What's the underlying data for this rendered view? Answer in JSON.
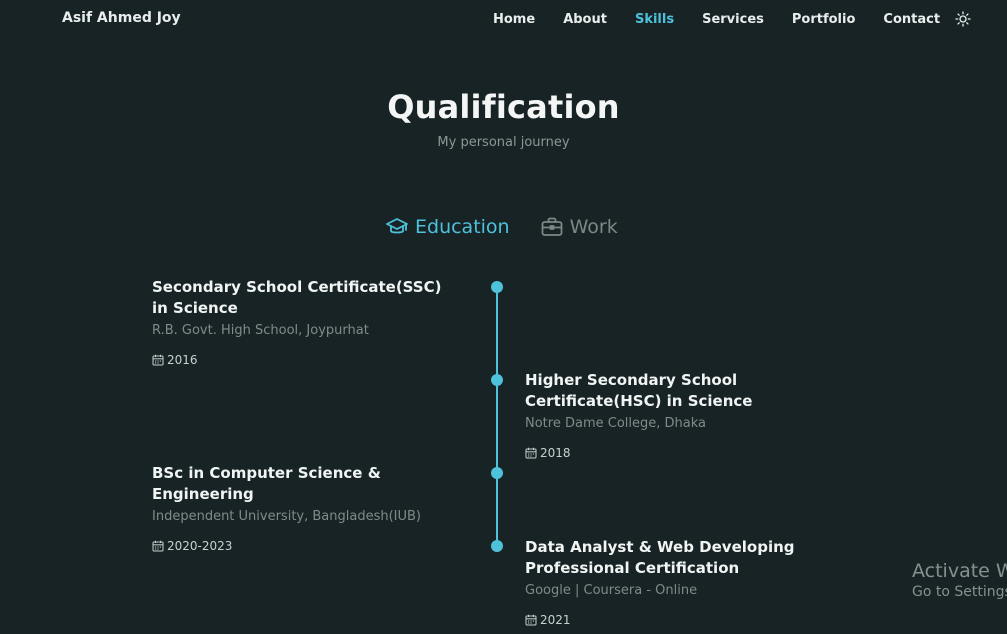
{
  "header": {
    "logo": "Asif Ahmed Joy",
    "nav": [
      "Home",
      "About",
      "Skills",
      "Services",
      "Portfolio",
      "Contact"
    ],
    "active_nav": "Skills",
    "theme_icon": "sun-icon"
  },
  "section": {
    "title": "Qualification",
    "subtitle": "My personal journey"
  },
  "tabs": {
    "education": {
      "label": "Education",
      "icon": "graduation-cap-icon",
      "active": true
    },
    "work": {
      "label": "Work",
      "icon": "briefcase-icon",
      "active": false
    }
  },
  "timeline": [
    {
      "title": "Secondary School Certificate(SSC) in Science",
      "subtitle": "R.B. Govt. High School, Joypurhat",
      "date": "2016",
      "side": "left"
    },
    {
      "title": "Higher Secondary School Certificate(HSC) in Science",
      "subtitle": "Notre Dame College, Dhaka",
      "date": "2018",
      "side": "right"
    },
    {
      "title": "BSc in Computer Science & Engineering",
      "subtitle": "Independent University, Bangladesh(IUB)",
      "date": "2020-2023",
      "side": "left"
    },
    {
      "title": "Data Analyst & Web Developing Professional Certification",
      "subtitle": "Google | Coursera - Online",
      "date": "2021",
      "side": "right"
    }
  ],
  "watermark": {
    "title": "Activate W",
    "subtitle": "Go to Settings"
  },
  "colors": {
    "background": "#182326",
    "accent": "#4ec1db",
    "muted": "#7f8b89"
  }
}
